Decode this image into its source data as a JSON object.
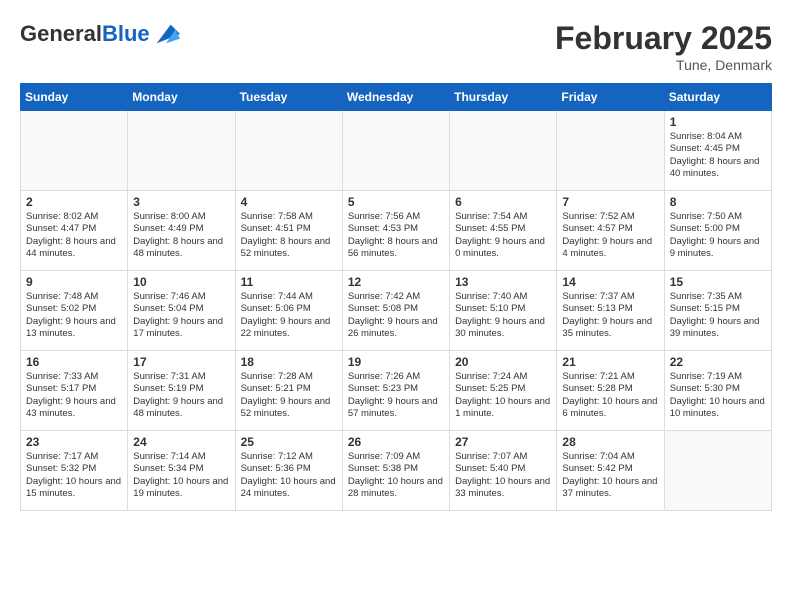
{
  "header": {
    "logo_general": "General",
    "logo_blue": "Blue",
    "month_year": "February 2025",
    "location": "Tune, Denmark"
  },
  "days_of_week": [
    "Sunday",
    "Monday",
    "Tuesday",
    "Wednesday",
    "Thursday",
    "Friday",
    "Saturday"
  ],
  "weeks": [
    [
      {
        "day": "",
        "empty": true
      },
      {
        "day": "",
        "empty": true
      },
      {
        "day": "",
        "empty": true
      },
      {
        "day": "",
        "empty": true
      },
      {
        "day": "",
        "empty": true
      },
      {
        "day": "",
        "empty": true
      },
      {
        "day": "1",
        "info": "Sunrise: 8:04 AM\nSunset: 4:45 PM\nDaylight: 8 hours and 40 minutes."
      }
    ],
    [
      {
        "day": "2",
        "info": "Sunrise: 8:02 AM\nSunset: 4:47 PM\nDaylight: 8 hours and 44 minutes."
      },
      {
        "day": "3",
        "info": "Sunrise: 8:00 AM\nSunset: 4:49 PM\nDaylight: 8 hours and 48 minutes."
      },
      {
        "day": "4",
        "info": "Sunrise: 7:58 AM\nSunset: 4:51 PM\nDaylight: 8 hours and 52 minutes."
      },
      {
        "day": "5",
        "info": "Sunrise: 7:56 AM\nSunset: 4:53 PM\nDaylight: 8 hours and 56 minutes."
      },
      {
        "day": "6",
        "info": "Sunrise: 7:54 AM\nSunset: 4:55 PM\nDaylight: 9 hours and 0 minutes."
      },
      {
        "day": "7",
        "info": "Sunrise: 7:52 AM\nSunset: 4:57 PM\nDaylight: 9 hours and 4 minutes."
      },
      {
        "day": "8",
        "info": "Sunrise: 7:50 AM\nSunset: 5:00 PM\nDaylight: 9 hours and 9 minutes."
      }
    ],
    [
      {
        "day": "9",
        "info": "Sunrise: 7:48 AM\nSunset: 5:02 PM\nDaylight: 9 hours and 13 minutes."
      },
      {
        "day": "10",
        "info": "Sunrise: 7:46 AM\nSunset: 5:04 PM\nDaylight: 9 hours and 17 minutes."
      },
      {
        "day": "11",
        "info": "Sunrise: 7:44 AM\nSunset: 5:06 PM\nDaylight: 9 hours and 22 minutes."
      },
      {
        "day": "12",
        "info": "Sunrise: 7:42 AM\nSunset: 5:08 PM\nDaylight: 9 hours and 26 minutes."
      },
      {
        "day": "13",
        "info": "Sunrise: 7:40 AM\nSunset: 5:10 PM\nDaylight: 9 hours and 30 minutes."
      },
      {
        "day": "14",
        "info": "Sunrise: 7:37 AM\nSunset: 5:13 PM\nDaylight: 9 hours and 35 minutes."
      },
      {
        "day": "15",
        "info": "Sunrise: 7:35 AM\nSunset: 5:15 PM\nDaylight: 9 hours and 39 minutes."
      }
    ],
    [
      {
        "day": "16",
        "info": "Sunrise: 7:33 AM\nSunset: 5:17 PM\nDaylight: 9 hours and 43 minutes."
      },
      {
        "day": "17",
        "info": "Sunrise: 7:31 AM\nSunset: 5:19 PM\nDaylight: 9 hours and 48 minutes."
      },
      {
        "day": "18",
        "info": "Sunrise: 7:28 AM\nSunset: 5:21 PM\nDaylight: 9 hours and 52 minutes."
      },
      {
        "day": "19",
        "info": "Sunrise: 7:26 AM\nSunset: 5:23 PM\nDaylight: 9 hours and 57 minutes."
      },
      {
        "day": "20",
        "info": "Sunrise: 7:24 AM\nSunset: 5:25 PM\nDaylight: 10 hours and 1 minute."
      },
      {
        "day": "21",
        "info": "Sunrise: 7:21 AM\nSunset: 5:28 PM\nDaylight: 10 hours and 6 minutes."
      },
      {
        "day": "22",
        "info": "Sunrise: 7:19 AM\nSunset: 5:30 PM\nDaylight: 10 hours and 10 minutes."
      }
    ],
    [
      {
        "day": "23",
        "info": "Sunrise: 7:17 AM\nSunset: 5:32 PM\nDaylight: 10 hours and 15 minutes."
      },
      {
        "day": "24",
        "info": "Sunrise: 7:14 AM\nSunset: 5:34 PM\nDaylight: 10 hours and 19 minutes."
      },
      {
        "day": "25",
        "info": "Sunrise: 7:12 AM\nSunset: 5:36 PM\nDaylight: 10 hours and 24 minutes."
      },
      {
        "day": "26",
        "info": "Sunrise: 7:09 AM\nSunset: 5:38 PM\nDaylight: 10 hours and 28 minutes."
      },
      {
        "day": "27",
        "info": "Sunrise: 7:07 AM\nSunset: 5:40 PM\nDaylight: 10 hours and 33 minutes."
      },
      {
        "day": "28",
        "info": "Sunrise: 7:04 AM\nSunset: 5:42 PM\nDaylight: 10 hours and 37 minutes."
      },
      {
        "day": "",
        "empty": true
      }
    ]
  ]
}
